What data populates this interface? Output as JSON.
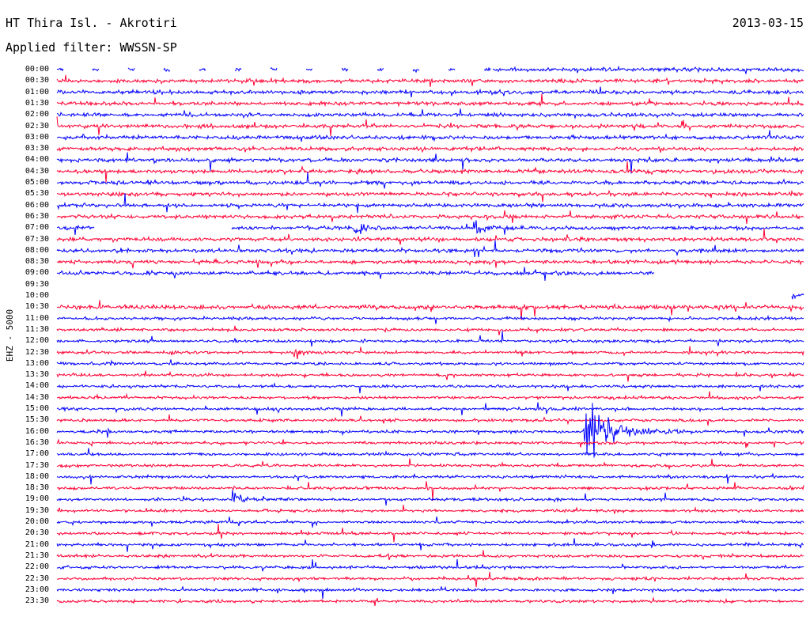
{
  "header": {
    "station": "HT Thira Isl. - Akrotiri",
    "date": "2013-03-15",
    "filter": "Applied filter: WWSSN-SP",
    "channel": "EHZ - 5000"
  },
  "chart_data": {
    "type": "line",
    "title": "HT Thira Isl. - Akrotiri",
    "date": "2013-03-15",
    "filter": "WWSSN-SP",
    "channel": "EHZ - 5000",
    "ylabel": "EHZ - 5000",
    "row_minutes": 30,
    "colors": [
      "#0000ff",
      "#ff0033"
    ],
    "tick_labels": [
      "00:00",
      "00:30",
      "01:00",
      "01:30",
      "02:00",
      "02:30",
      "03:00",
      "03:30",
      "04:00",
      "04:30",
      "05:00",
      "05:30",
      "06:00",
      "06:30",
      "07:00",
      "07:30",
      "08:00",
      "08:30",
      "09:00",
      "09:30",
      "10:00",
      "10:30",
      "11:00",
      "11:30",
      "12:00",
      "12:30",
      "13:00",
      "13:30",
      "14:00",
      "14:30",
      "15:00",
      "15:30",
      "16:00",
      "16:30",
      "17:00",
      "17:30",
      "18:00",
      "18:30",
      "19:00",
      "19:30",
      "20:00",
      "20:30",
      "21:00",
      "21:30",
      "22:00",
      "22:30",
      "23:00",
      "23:30"
    ],
    "data_gaps": [
      {
        "label": "00:00",
        "from_min": 0,
        "to_min": 17.5,
        "note": "intermittent data"
      },
      {
        "label": "07:00",
        "from_min": 1.5,
        "to_min": 7
      },
      {
        "label": "09:00",
        "from_min": 24,
        "to_min": 30
      },
      {
        "label": "09:30",
        "from_min": 0,
        "to_min": 30
      },
      {
        "label": "10:00",
        "from_min": 0,
        "to_min": 29.5
      }
    ],
    "events": [
      {
        "label": "16:00",
        "minute": 21.2,
        "relative_amplitude": 1.0,
        "note": "largest event, coda across 15:00-17:30 rows"
      },
      {
        "label": "12:30",
        "minute": 9.5,
        "relative_amplitude": 0.3
      },
      {
        "label": "19:00",
        "minute": 7.1,
        "relative_amplitude": 0.25
      },
      {
        "label": "07:00",
        "minute": 12.0,
        "relative_amplitude": 0.3
      },
      {
        "label": "07:00",
        "minute": 16.8,
        "relative_amplitude": 0.3
      }
    ]
  }
}
